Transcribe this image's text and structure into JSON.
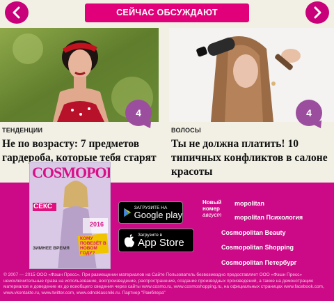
{
  "header": {
    "title": "СЕЙЧАС ОБСУЖДАЮТ"
  },
  "cards": [
    {
      "category": "ТЕНДЕНЦИИ",
      "title": "Не по возрасту: 7 предметов гардероба, которые тебя старят",
      "comments": "4"
    },
    {
      "category": "ВОЛОСЫ",
      "title": "Ты не должна платить! 10 типичных конфликтов в салоне красоты",
      "comments": "4"
    }
  ],
  "magazine": {
    "logo": "COSMOPOLITAN",
    "cover_lines": [
      "СЕКС",
      "2016",
      "КОМУ ПОВЕЗЁТ В НОВОМ ГОДУ?",
      "ЗИМНЕЕ ВРЕМЯ"
    ]
  },
  "stores": {
    "google": {
      "small": "ЗАГРУЗИТЕ НА",
      "big": "Google play"
    },
    "apple": {
      "small": "Загрузите в",
      "big": "App Store"
    }
  },
  "new_issue": {
    "line1": "Новый",
    "line2": "номер",
    "month": "август"
  },
  "links": [
    "mopolitan",
    "mopolitan Психология",
    "Cosmopolitan Beauty",
    "Cosmopolitan Shopping",
    "Cosmopolitan Петербург"
  ],
  "footer": "© 2007 — 2015 ООО «Фэшн Пресс». При размещении материалов на Сайте Пользователь безвозмездно предоставляет ООО «Фэшн Пресс» неисключительные права на использование, воспроизведение, распространение, создание производных произведений, а также на демонстрацию материалов и доведение их до всеобщего сведения через сайты www.cosmo.ru, www.cosmoshopping.ru, на официальных страницах www.facebook.com, www.vkontakte.ru, www.twitter.com, www.odnoklassniki.ru. Партнер \"Рамблера\""
}
